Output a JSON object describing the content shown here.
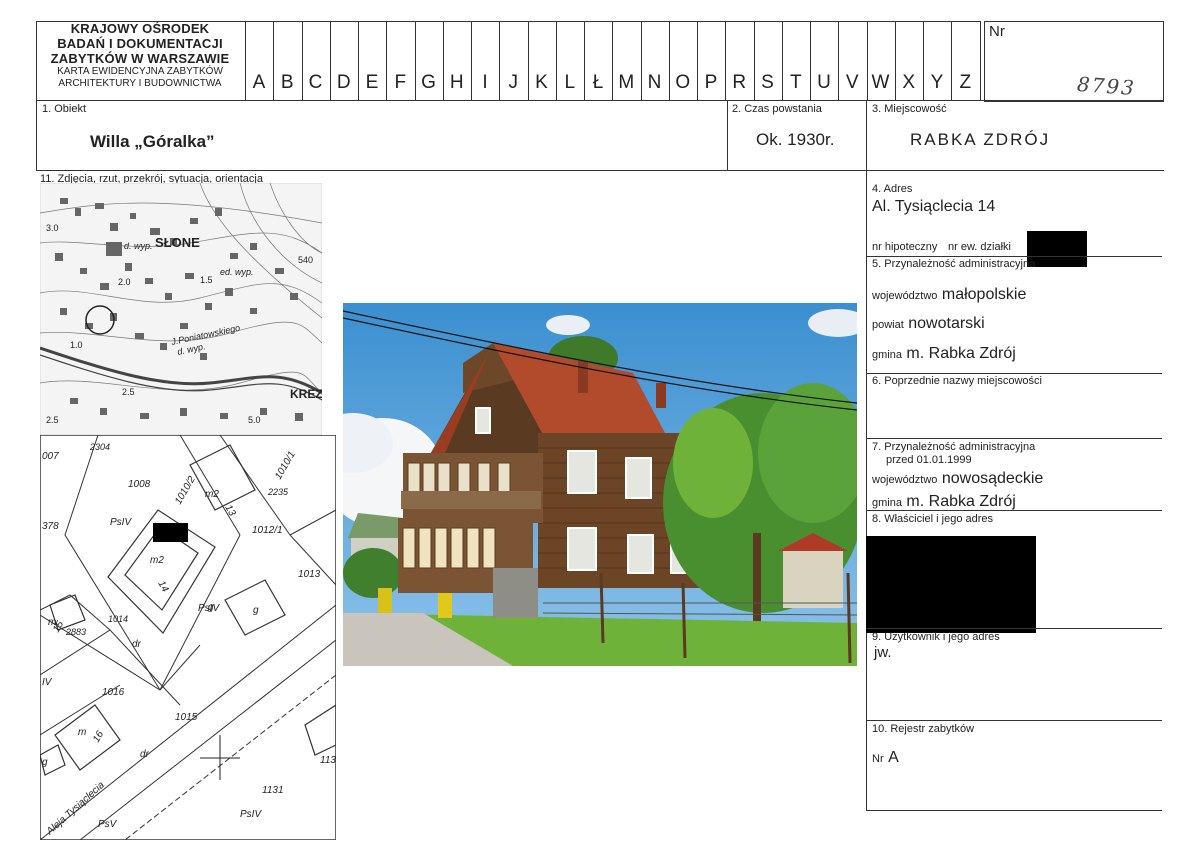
{
  "header": {
    "institution_lines": [
      "KRAJOWY OŚRODEK",
      "BADAŃ I DOKUMENTACJI",
      "ZABYTKÓW W WARSZAWIE"
    ],
    "card_title_lines": [
      "KARTA EWIDENCYJNA ZABYTKÓW",
      "ARCHITEKTURY I BUDOWNICTWA"
    ],
    "letters": [
      "A",
      "B",
      "C",
      "D",
      "E",
      "F",
      "G",
      "H",
      "I",
      "J",
      "K",
      "L",
      "Ł",
      "M",
      "N",
      "O",
      "P",
      "R",
      "S",
      "T",
      "U",
      "V",
      "W",
      "X",
      "Y",
      "Z"
    ],
    "nr_label": "Nr",
    "nr_value": "8793"
  },
  "fields": {
    "obiekt_label": "1. Obiekt",
    "obiekt_value": "Willa „Góralka”",
    "czas_label": "2. Czas powstania",
    "czas_value": "Ok. 1930r.",
    "miejscowosc_label": "3. Miejscowość",
    "miejscowosc_value": "RABKA ZDRÓJ",
    "photo_section_label": "11. Zdjęcia, rzut, przekrój, sytuacja, orientacja",
    "adres_label": "4. Adres",
    "adres_value": "Al. Tysiąclecia 14",
    "hipoteczny_label": "nr hipoteczny",
    "dzialki_label": "nr ew. działki",
    "admin_label": "5. Przynależność administracyjna",
    "woj_label": "województwo",
    "woj_value": "małopolskie",
    "powiat_label": "powiat",
    "powiat_value": "nowotarski",
    "gmina_label": "gmina",
    "gmina_value": "m. Rabka Zdrój",
    "poprzednie_label": "6. Poprzednie nazwy miejscowości",
    "admin_prev_label_1": "7. Przynależność administracyjna",
    "admin_prev_label_2": "przed 01.01.1999",
    "woj_prev_label": "województwo",
    "woj_prev_value": "nowosądeckie",
    "gmina_prev_label": "gmina",
    "gmina_prev_value": "m. Rabka Zdrój",
    "wlasciciel_label": "8. Właściciel i jego adres",
    "uzytkownik_label": "9. Użytkownik i jego adres",
    "uzytkownik_value": "jw.",
    "rejestr_label": "10. Rejestr zabytków",
    "rejestr_nr_label": "Nr",
    "rejestr_nr_value": "A"
  },
  "map_top": {
    "labels": [
      "SŁONE",
      "d. wyp.",
      "ed. wyp.",
      "3.0",
      "2.0",
      "1.5",
      "1.0",
      "2.5",
      "2.5",
      "5.0",
      "540",
      "KREZ",
      "J.Poniatowskiego",
      "d. wyp."
    ]
  },
  "map_cadastral": {
    "labels": [
      "007",
      "2304",
      "1008",
      "1010/2",
      "1010/1",
      "2235",
      "m2",
      "13",
      "1012/1",
      "1013",
      "PsIV",
      "m2",
      "14",
      "PsIV",
      "g",
      "378",
      "m",
      "15",
      "2883",
      "1014",
      "dr",
      "IV",
      "1016",
      "1015",
      "m",
      "16",
      "g",
      "dr",
      "113",
      "1131",
      "PsIV",
      "Aleja Tysiąclecia",
      "PsV",
      "g"
    ]
  },
  "colors": {
    "line": "#333333",
    "redaction": "#000000",
    "sky": "#4f9fd8",
    "roof": "#b24a2c",
    "wood": "#6b4526",
    "grass": "#6fb23a"
  }
}
